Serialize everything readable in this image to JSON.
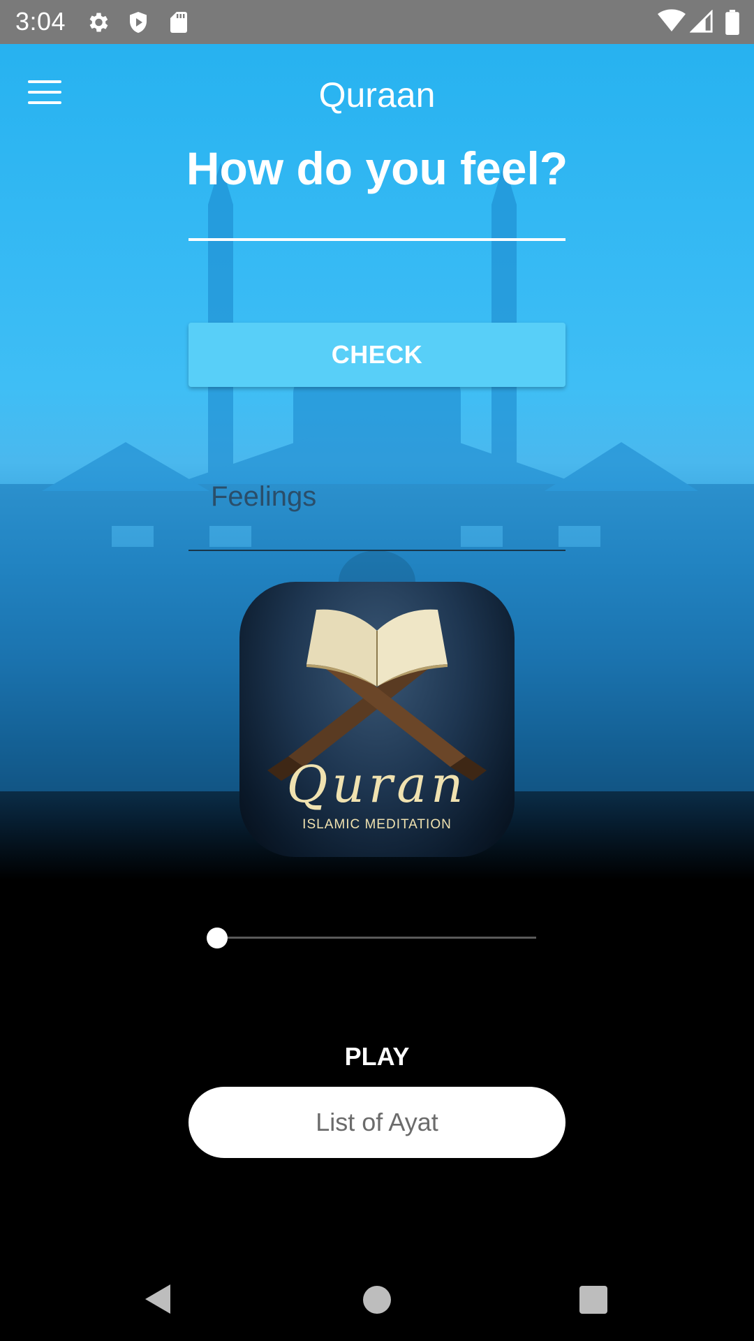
{
  "status_bar": {
    "time": "3:04",
    "icons": [
      "gear-icon",
      "shield-icon",
      "sd-card-icon",
      "wifi-icon",
      "signal-icon",
      "battery-icon"
    ]
  },
  "app_bar": {
    "title": "Quraan",
    "menu_icon": "hamburger-menu-icon"
  },
  "main": {
    "headline": "How do you feel?",
    "feeling_input_value": "",
    "check_label": "CHECK",
    "feelings_placeholder": "Feelings",
    "cover": {
      "title": "Quran",
      "subtitle": "ISLAMIC MEDITATION"
    },
    "player": {
      "progress": 0.0,
      "play_label": "PLAY"
    },
    "list_button_label": "List of Ayat"
  },
  "nav_bar": {
    "icons": [
      "back-icon",
      "home-icon",
      "recents-icon"
    ]
  },
  "colors": {
    "sky_top": "#27b2f0",
    "check_button": "#58cff8",
    "background_bottom": "#000000",
    "cover_text": "#f0e2b0"
  }
}
